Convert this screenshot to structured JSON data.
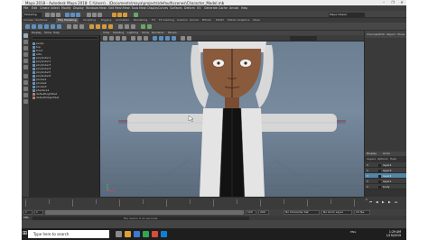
{
  "window": {
    "title": "Maya 2018 - Autodesk Maya 2018: C:\\Users\\...\\Documents\\maya\\projects\\default\\scenes\\Character_Model.mb",
    "controls": [
      "–",
      "❐",
      "✕"
    ]
  },
  "menubar": {
    "items": [
      "File",
      "Edit",
      "Create",
      "Select",
      "Modify",
      "Display",
      "Windows",
      "Mesh",
      "Edit Mesh",
      "Mesh Tools",
      "Mesh Display",
      "Curves",
      "Surfaces",
      "Deform",
      "UV",
      "Generate",
      "Cache",
      "Arnold",
      "Help"
    ]
  },
  "status_line": {
    "mode": "Modeling",
    "workspace": "Maya Classic"
  },
  "shelf": {
    "tabs": [
      "Curves / Surfaces",
      "Poly Modeling",
      "Sculpting",
      "Rigging",
      "Animation",
      "Rendering",
      "FX",
      "FX Caching",
      "Custom",
      "Arnold",
      "Bifrost",
      "MASH",
      "Motion Graphics",
      "XGen"
    ],
    "active_tab": "Poly Modeling"
  },
  "outliner": {
    "menu": [
      "Display",
      "Show",
      "Help"
    ],
    "items": [
      "persp",
      "top",
      "front",
      "side",
      "pCylinder1",
      "pCylinder2",
      "pCylinder3",
      "pCylinder4",
      "pCylinder5",
      "pCylinder6",
      "pCube1",
      "pCube2",
      "pCube3",
      "pSphere1",
      "defaultLightSet",
      "defaultObjectSet"
    ]
  },
  "viewport": {
    "menu": [
      "View",
      "Shading",
      "Lighting",
      "Show",
      "Renderer",
      "Panels"
    ],
    "camera": "persp"
  },
  "right_panel": {
    "tabs": [
      "Channels",
      "Edit",
      "Object",
      "Show"
    ]
  },
  "layer_editor": {
    "tabs": [
      "Display",
      "Anim"
    ],
    "submenu": [
      "Layers",
      "Options",
      "Help"
    ],
    "layers": [
      {
        "vis": "V",
        "name": "layer4",
        "selected": false
      },
      {
        "vis": "V",
        "name": "layer3",
        "selected": false
      },
      {
        "vis": "V",
        "name": "layer2",
        "selected": true
      },
      {
        "vis": "V",
        "name": "layer1",
        "selected": false
      },
      {
        "vis": "V",
        "name": "body",
        "selected": false
      }
    ]
  },
  "time_slider": {
    "current": "1",
    "range_start": "1",
    "range_end": "120",
    "anim_start": "1",
    "anim_end": "200",
    "character": "No Character Set",
    "anim_layer": "No Anim Layer",
    "fps": "24 fps"
  },
  "command_line": {
    "label": "MEL",
    "result": "File read in 0.11 seconds."
  },
  "taskbar": {
    "search_placeholder": "Type here to search",
    "lang": "ENG",
    "time": "1:29 AM",
    "date": "1/19/2019",
    "colors": [
      "#e0a030",
      "#3a7bd5",
      "#2fa84f",
      "#d94b3b",
      "#0f7fd4",
      "#8a8a8a"
    ]
  }
}
